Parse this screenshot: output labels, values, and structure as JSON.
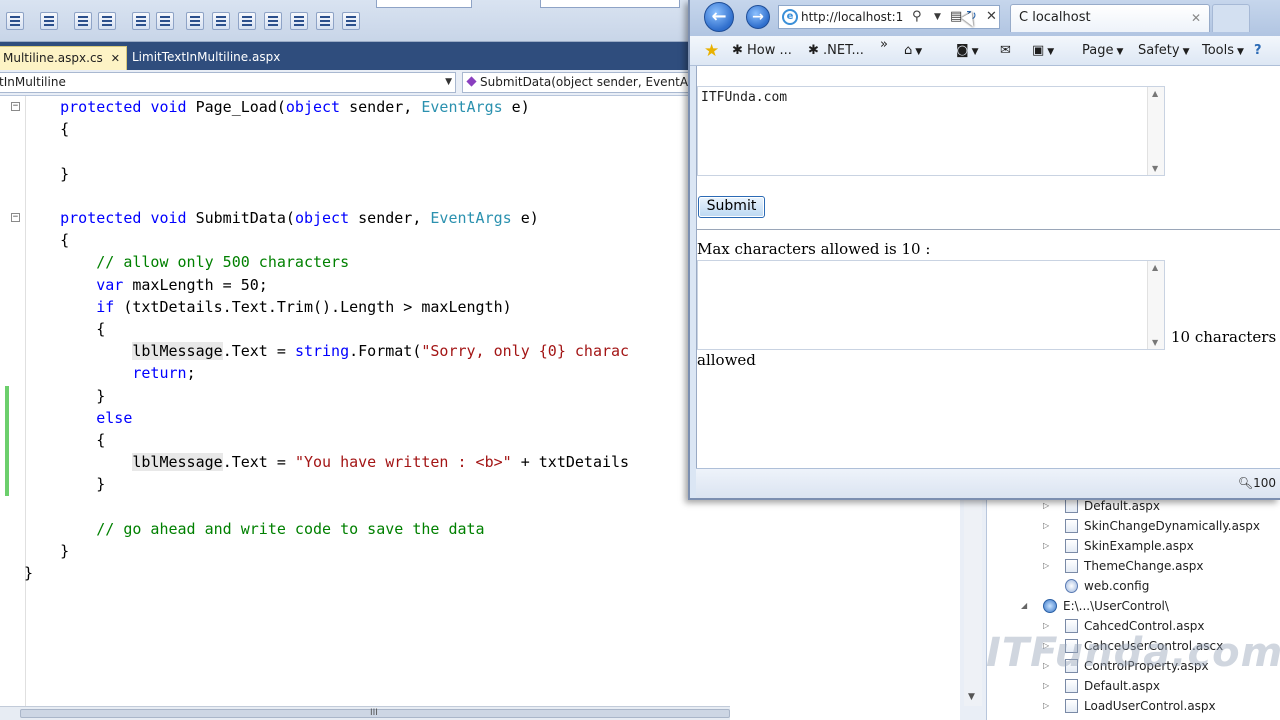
{
  "vs": {
    "tabs": [
      {
        "label": "Multiline.aspx.cs",
        "close": "✕"
      },
      {
        "label": "LimitTextInMultiline.aspx"
      }
    ],
    "nav": {
      "class_dropdown": "tInMultiline",
      "method_dropdown": "SubmitData(object sender, EventArgs"
    },
    "code_lines": [
      [
        {
          "t": "    "
        },
        {
          "t": "protected",
          "c": "kw"
        },
        {
          "t": " "
        },
        {
          "t": "void",
          "c": "kw"
        },
        {
          "t": " Page_Load("
        },
        {
          "t": "object",
          "c": "kw"
        },
        {
          "t": " sender, "
        },
        {
          "t": "EventArgs",
          "c": "ty"
        },
        {
          "t": " e)"
        }
      ],
      [
        {
          "t": "    {"
        }
      ],
      [
        {
          "t": ""
        }
      ],
      [
        {
          "t": "    }"
        }
      ],
      [
        {
          "t": ""
        }
      ],
      [
        {
          "t": "    "
        },
        {
          "t": "protected",
          "c": "kw"
        },
        {
          "t": " "
        },
        {
          "t": "void",
          "c": "kw"
        },
        {
          "t": " SubmitData("
        },
        {
          "t": "object",
          "c": "kw"
        },
        {
          "t": " sender, "
        },
        {
          "t": "EventArgs",
          "c": "ty"
        },
        {
          "t": " e)"
        }
      ],
      [
        {
          "t": "    {"
        }
      ],
      [
        {
          "t": "        "
        },
        {
          "t": "// allow only 500 characters",
          "c": "cm"
        }
      ],
      [
        {
          "t": "        "
        },
        {
          "t": "var",
          "c": "kw"
        },
        {
          "t": " maxLength = 50;"
        }
      ],
      [
        {
          "t": "        "
        },
        {
          "t": "if",
          "c": "kw"
        },
        {
          "t": " (txtDetails.Text.Trim().Length > maxLength)"
        }
      ],
      [
        {
          "t": "        {"
        }
      ],
      [
        {
          "t": "            "
        },
        {
          "t": "lblMessage",
          "c": "hl"
        },
        {
          "t": ".Text = "
        },
        {
          "t": "string",
          "c": "kw"
        },
        {
          "t": ".Format("
        },
        {
          "t": "\"Sorry, only {0} charac",
          "c": "st"
        }
      ],
      [
        {
          "t": "            "
        },
        {
          "t": "return",
          "c": "kw"
        },
        {
          "t": ";"
        }
      ],
      [
        {
          "t": "        }"
        }
      ],
      [
        {
          "t": "        "
        },
        {
          "t": "else",
          "c": "kw"
        }
      ],
      [
        {
          "t": "        {"
        }
      ],
      [
        {
          "t": "            "
        },
        {
          "t": "lblMessage",
          "c": "hl"
        },
        {
          "t": ".Text = "
        },
        {
          "t": "\"You have written : <b>\"",
          "c": "st"
        },
        {
          "t": " + txtDetails"
        }
      ],
      [
        {
          "t": "        }"
        }
      ],
      [
        {
          "t": ""
        }
      ],
      [
        {
          "t": "        "
        },
        {
          "t": "// go ahead and write code to save the data",
          "c": "cm"
        }
      ],
      [
        {
          "t": "    }"
        }
      ],
      [
        {
          "t": "}"
        }
      ]
    ],
    "hscroll_grip": "III"
  },
  "solution_explorer": {
    "items": [
      {
        "label": "Default.aspx",
        "icon": "aspx-file-icon",
        "expander": "▷"
      },
      {
        "label": "SkinChangeDynamically.aspx",
        "icon": "aspx-file-icon",
        "expander": "▷"
      },
      {
        "label": "SkinExample.aspx",
        "icon": "aspx-file-icon",
        "expander": "▷"
      },
      {
        "label": "ThemeChange.aspx",
        "icon": "aspx-file-icon",
        "expander": "▷"
      },
      {
        "label": "web.config",
        "icon": "config-file-icon",
        "expander": ""
      },
      {
        "label": "E:\\...\\UserControl\\",
        "icon": "web-project-icon",
        "expander": "◢"
      },
      {
        "label": "CahcedControl.aspx",
        "icon": "aspx-file-icon",
        "expander": "▷"
      },
      {
        "label": "CahceUserControl.ascx",
        "icon": "ascx-file-icon",
        "expander": "▷"
      },
      {
        "label": "ControlProperty.aspx",
        "icon": "aspx-file-icon",
        "expander": "▷"
      },
      {
        "label": "Default.aspx",
        "icon": "aspx-file-icon",
        "expander": "▷"
      },
      {
        "label": "LoadUserControl.aspx",
        "icon": "aspx-file-icon",
        "expander": "▷"
      }
    ]
  },
  "watermark": "ITFunda.com",
  "ie": {
    "address": "http://localhost:1",
    "tab_title": "localhost",
    "tab_close": "✕",
    "back_glyph": "←",
    "forward_glyph": "→",
    "favorites": [
      "How ...",
      ".NET..."
    ],
    "more_glyph": "»",
    "commands": [
      "Page",
      "Safety",
      "Tools"
    ],
    "dropdown_glyph": "▼",
    "input_text": "ITFUnda.com",
    "submit_label": "Submit",
    "max_label": "Max characters allowed is 10 :",
    "limit_label": "10 characters",
    "allowed_label": "allowed",
    "zoom": "100"
  }
}
